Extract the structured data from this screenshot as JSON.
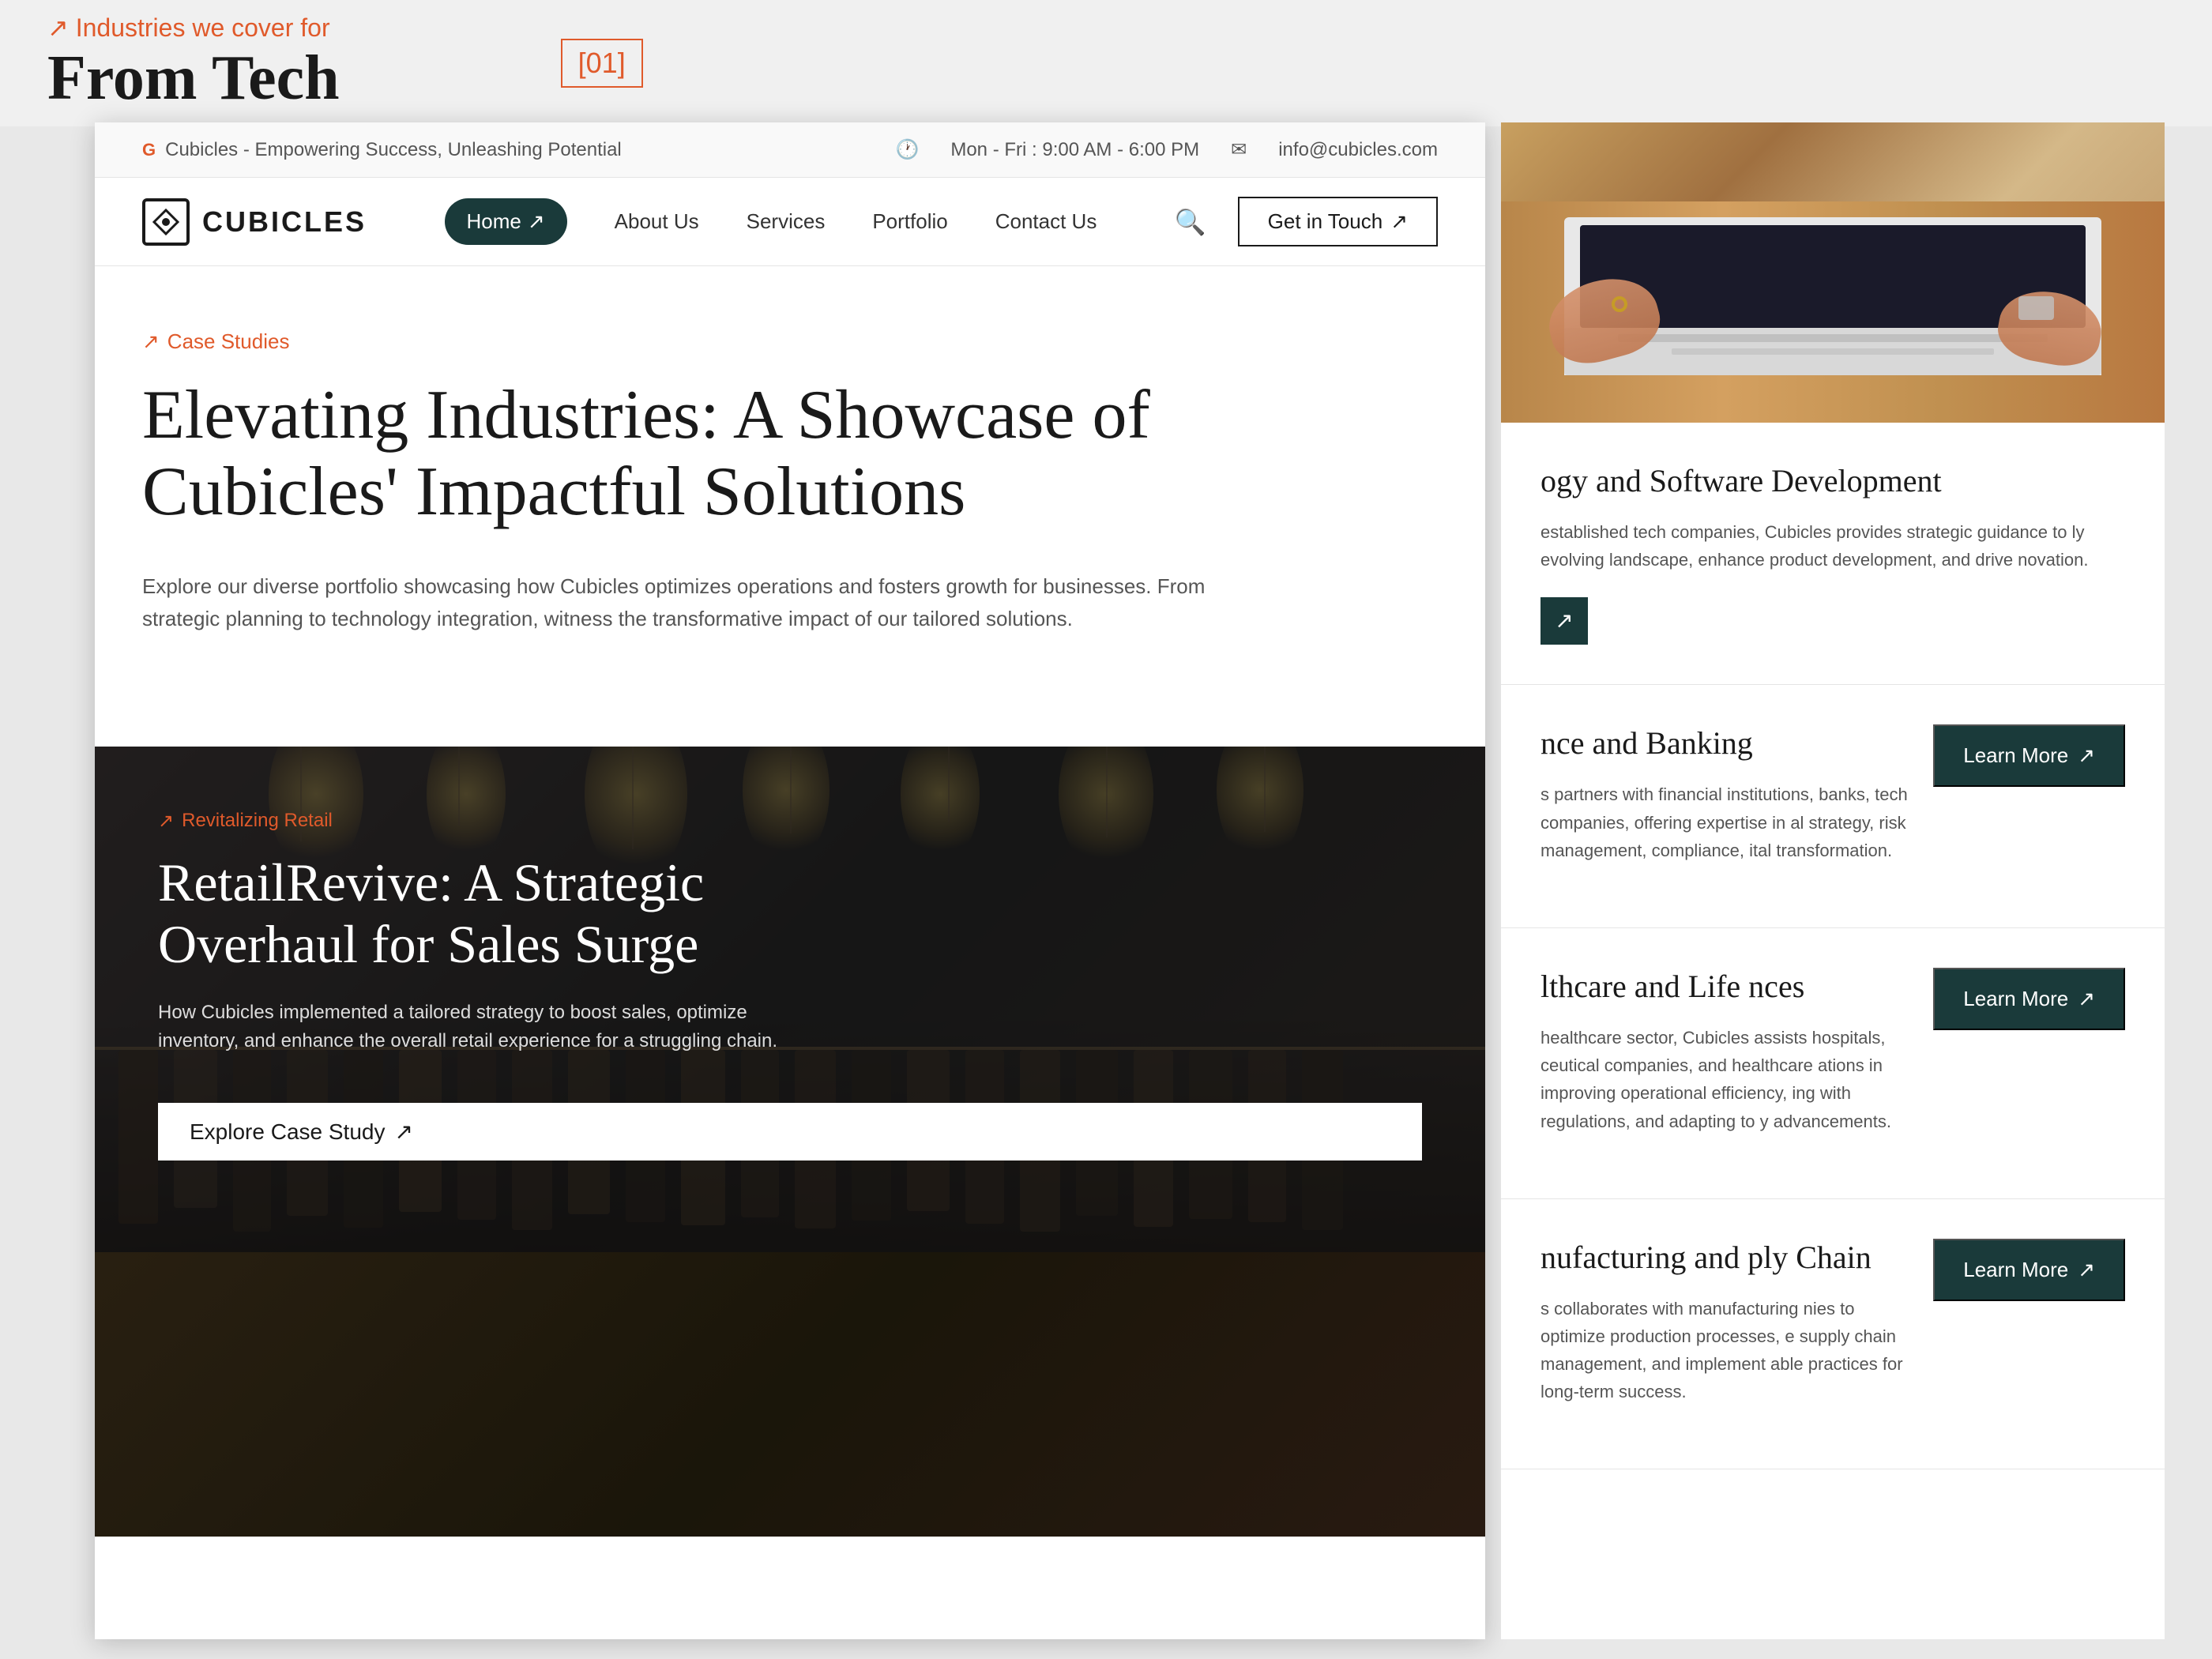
{
  "topBanner": {
    "subtitle": "↗ Industries we cover for",
    "title": "From Tech",
    "counter": "[01]"
  },
  "topBar": {
    "clock_icon": "🕐",
    "hours": "Mon - Fri : 9:00 AM - 6:00 PM",
    "email_icon": "✉",
    "email": "info@cubicles.com",
    "favicon_alt": "G",
    "page_title": "Cubicles - Empowering Success, Unleashing Potential"
  },
  "navbar": {
    "logo_text": "CUBICLES",
    "nav_home": "Home",
    "nav_about": "About Us",
    "nav_services": "Services",
    "nav_portfolio": "Portfolio",
    "nav_contact": "Contact Us",
    "get_in_touch": "Get in Touch",
    "arrow": "↗"
  },
  "hero": {
    "tag_arrow": "↗",
    "tag": "Case Studies",
    "title": "Elevating Industries: A Showcase of Cubicles' Impactful Solutions",
    "description": "Explore our diverse portfolio showcasing how Cubicles optimizes operations and fosters growth for businesses. From strategic planning to technology integration, witness the transformative impact of our tailored solutions."
  },
  "caseStudyCard": {
    "tag_arrow": "↗",
    "tag": "Revitalizing Retail",
    "title": "RetailRevive: A Strategic Overhaul for Sales Surge",
    "description": "How Cubicles implemented a tailored strategy to boost sales, optimize inventory, and enhance the overall retail experience for a struggling chain.",
    "cta": "Explore Case Study",
    "arrow": "↗"
  },
  "rightPanel": {
    "techSection": {
      "title": "ogy and Software Development",
      "description": "established tech companies, Cubicles provides strategic guidance to ly evolving landscape, enhance product development, and drive novation.",
      "arrow": "↗"
    },
    "financeSection": {
      "title": "nce and Banking",
      "description": "s partners with financial institutions, banks, tech companies, offering expertise in al strategy, risk management, compliance, ital transformation.",
      "learn_more": "Learn More",
      "arrow": "↗"
    },
    "healthcareSection": {
      "title": "lthcare and Life nces",
      "description": "healthcare sector, Cubicles assists hospitals, ceutical companies, and healthcare ations in improving operational efficiency, ing with regulations, and adapting to y advancements.",
      "learn_more": "Learn More",
      "arrow": "↗"
    },
    "manufacturingSection": {
      "title": "nufacturing and ply Chain",
      "description": "s collaborates with manufacturing nies to optimize production processes, e supply chain management, and implement able practices for long-term success.",
      "learn_more": "Learn More",
      "arrow": "↗"
    }
  },
  "colors": {
    "accent": "#e05a2b",
    "dark": "#1a3a3a",
    "text": "#1a1a1a",
    "muted": "#555555"
  }
}
